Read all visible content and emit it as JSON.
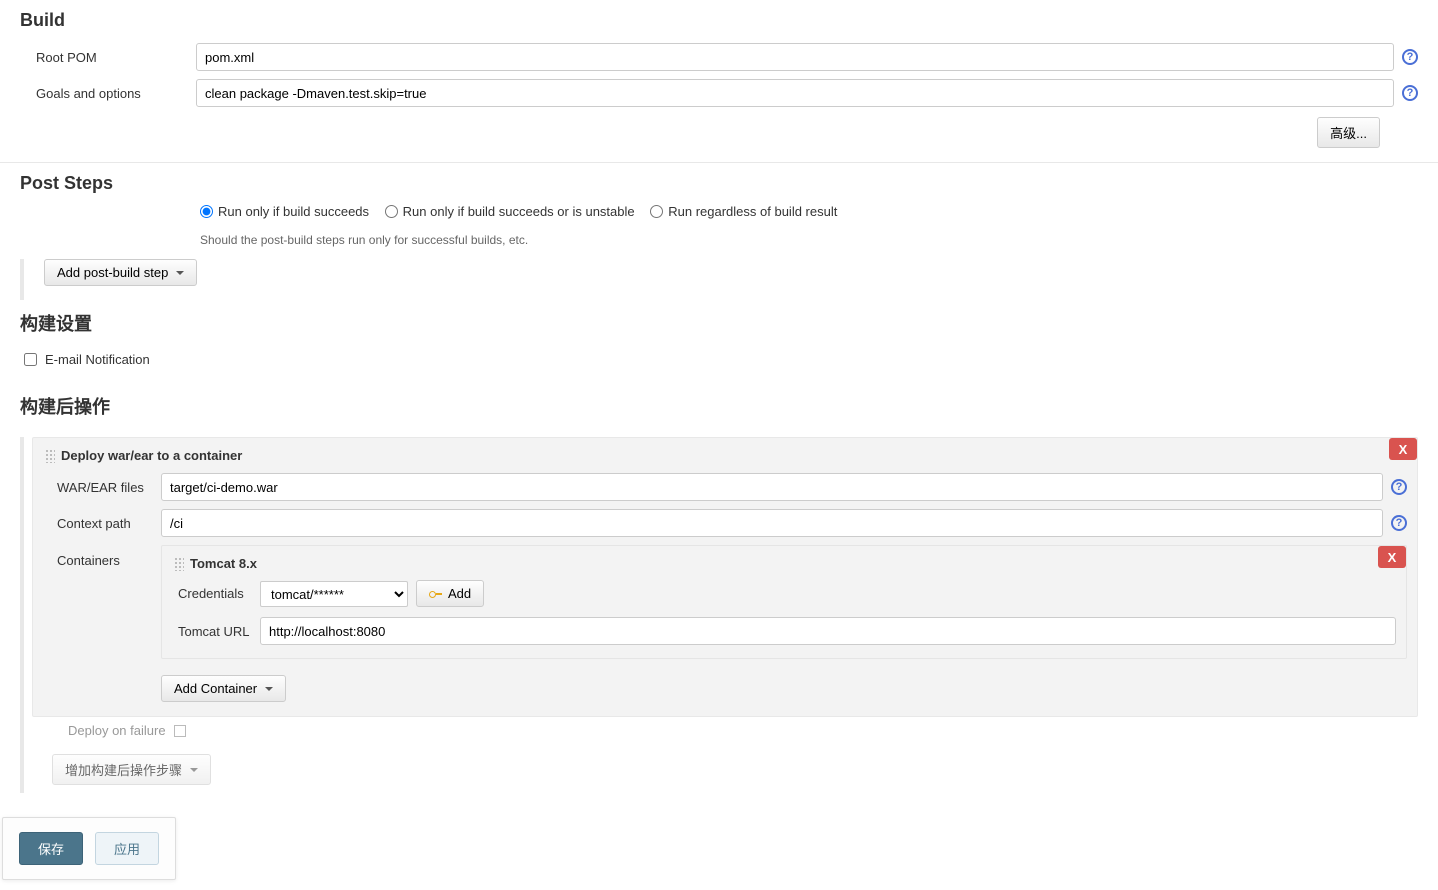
{
  "build": {
    "title": "Build",
    "root_pom_label": "Root POM",
    "root_pom_value": "pom.xml",
    "goals_label": "Goals and options",
    "goals_value": "clean package -Dmaven.test.skip=true",
    "advanced_label": "高级..."
  },
  "post_steps": {
    "title": "Post Steps",
    "radio1": "Run only if build succeeds",
    "radio2": "Run only if build succeeds or is unstable",
    "radio3": "Run regardless of build result",
    "hint": "Should the post-build steps run only for successful builds, etc.",
    "add_button": "Add post-build step"
  },
  "build_settings": {
    "title": "构建设置",
    "email_label": "E-mail Notification"
  },
  "post_build": {
    "title": "构建后操作",
    "deploy": {
      "block_title": "Deploy war/ear to a container",
      "war_label": "WAR/EAR files",
      "war_value": "target/ci-demo.war",
      "ctx_label": "Context path",
      "ctx_value": "/ci",
      "containers_label": "Containers",
      "container": {
        "name": "Tomcat 8.x",
        "cred_label": "Credentials",
        "cred_value": "tomcat/******",
        "add_cred_label": "Add",
        "url_label": "Tomcat URL",
        "url_value": "http://localhost:8080"
      },
      "add_container_label": "Add Container",
      "deploy_failure_label": "Deploy on failure"
    },
    "add_postbuild_label": "增加构建后操作步骤"
  },
  "icons": {
    "help": "?",
    "remove": "X"
  },
  "bottom_bar": {
    "save": "保存",
    "apply": "应用"
  }
}
